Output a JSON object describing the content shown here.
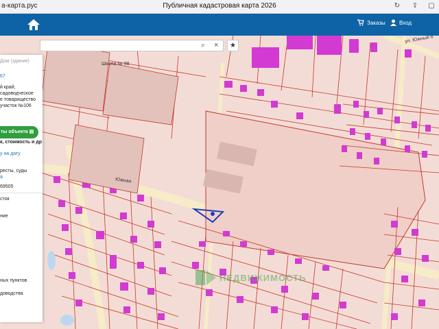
{
  "browser": {
    "url": "а-карта.рус",
    "title": "Публичная кадастровая карта 2026"
  },
  "topbar": {
    "orders_label": "Заказы",
    "login_label": "Вход",
    "brand_color": "#0d63a5"
  },
  "search": {
    "placeholder": ""
  },
  "panel": {
    "type_hint": "Дом (здание)",
    "number": "67",
    "address_lines": [
      "й край,",
      "садоводческое",
      "е товарищество",
      "участок №106"
    ],
    "object_button": "ты объекта",
    "subtitle": "к, стоимость и др",
    "date_link": "у на дату",
    "courts_lines": [
      "ресты, суды",
      "а"
    ],
    "code": "69505",
    "lines_bottom": [
      "сток",
      "ние",
      "ных пунктов",
      "доводства"
    ]
  },
  "map": {
    "street_label": "ул. Южный б",
    "street_label_2": "Южная",
    "school_label": "Школа № 98",
    "watermark": "НЕДВИЖИМОСТЬ",
    "colors": {
      "background": "#f4dcd6",
      "parcel_line": "#c0392b",
      "building": "#d23ad2",
      "road": "#f7ecc8",
      "water": "#bcd8ee"
    }
  }
}
